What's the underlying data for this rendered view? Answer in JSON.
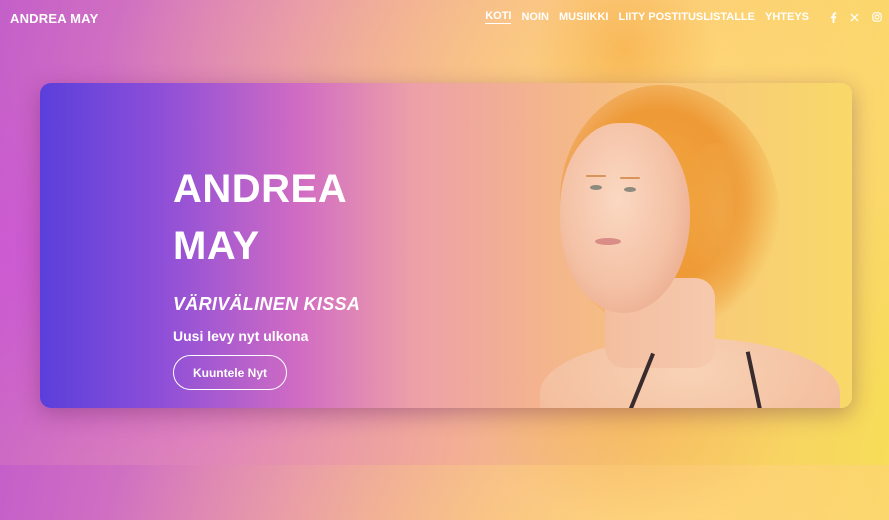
{
  "site": {
    "logo": "ANDREA MAY"
  },
  "nav": {
    "items": [
      {
        "label": "KOTI",
        "active": true
      },
      {
        "label": "NOIN",
        "active": false
      },
      {
        "label": "MUSIIKKI",
        "active": false
      },
      {
        "label": "LIITY POSTITUSLISTALLE",
        "active": false
      },
      {
        "label": "YHTEYS",
        "active": false
      }
    ],
    "social_icons": [
      "facebook-icon",
      "x-icon",
      "instagram-icon"
    ]
  },
  "hero": {
    "title_line1": "ANDREA",
    "title_line2": "MAY",
    "subtitle": "VÄRIVÄLINEN KISSA",
    "text": "Uusi levy nyt ulkona",
    "cta_label": "Kuuntele Nyt"
  },
  "colors": {
    "card_start": "#5a3fdb",
    "card_end": "#f9d969",
    "text": "#ffffff"
  }
}
